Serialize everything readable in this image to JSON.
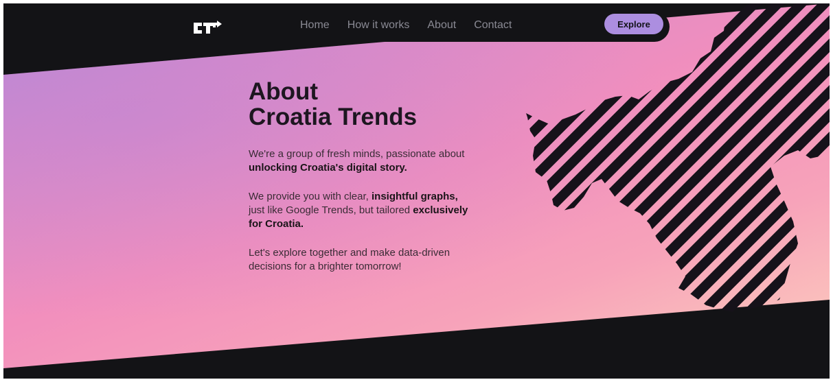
{
  "nav": {
    "links": [
      "Home",
      "How it works",
      "About",
      "Contact"
    ],
    "explore_label": "Explore"
  },
  "about": {
    "title_line1": "About",
    "title_line2": "Croatia Trends",
    "p1_a": "We're a group of fresh minds, passionate about ",
    "p1_b": "unlocking Croatia's digital story.",
    "p2_a": "We provide you with clear, ",
    "p2_b": "insightful graphs,",
    "p2_c": " just like Google Trends, but tailored ",
    "p2_d": "exclusively for Croatia.",
    "p3": "Let's explore together and make data-driven decisions for a brighter tomorrow!"
  },
  "colors": {
    "background": "#131316",
    "accent": "#ac8ee0",
    "gradient_start": "#b98ad6",
    "gradient_mid": "#f28fbd",
    "gradient_end": "#fdd2bd"
  },
  "icons": {
    "logo": "ct-arrow-logo",
    "map": "croatia-striped-map"
  }
}
